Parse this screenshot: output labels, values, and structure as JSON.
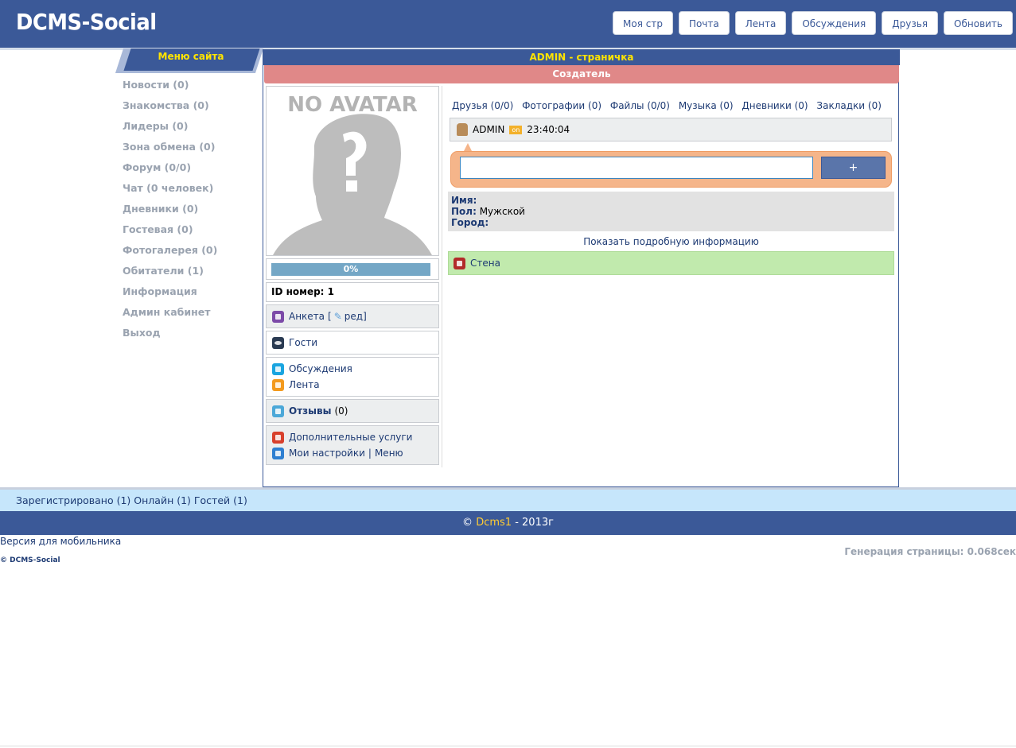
{
  "header": {
    "logo": "DCMS-Social",
    "nav": [
      "Моя стр",
      "Почта",
      "Лента",
      "Обсуждения",
      "Друзья",
      "Обновить"
    ]
  },
  "sidebar": {
    "title": "Меню сайта",
    "items": [
      "Новости (0)",
      "Знакомства (0)",
      "Лидеры (0)",
      "Зона обмена (0)",
      "Форум (0/0)",
      "Чат (0 человек)",
      "Дневники (0)",
      "Гостевая (0)",
      "Фотогалерея (0)",
      "Обитатели (1)",
      "Информация",
      "Админ кабинет",
      "Выход"
    ]
  },
  "profile": {
    "title": "ADMIN - страничка",
    "role": "Создатель",
    "avatar_text": "NO AVATAR",
    "progress": {
      "label": "0%",
      "value": 0
    },
    "id_label": "ID номер: 1",
    "anketa": "Анкета",
    "anketa_open": "[",
    "anketa_edit": "ред",
    "anketa_close": "]",
    "guests": "Гости",
    "discussions": "Обсуждения",
    "feed": "Лента",
    "reviews_label": "Отзывы",
    "reviews_count": "(0)",
    "extra_services": "Дополнительные услуги",
    "my_settings": "Мои настройки",
    "separator": "|",
    "menu": "Меню"
  },
  "tabs": [
    "Друзья (0/0)",
    "Фотографии (0)",
    "Файлы (0/0)",
    "Музыка (0)",
    "Дневники (0)",
    "Закладки (0)"
  ],
  "status": {
    "user": "ADMIN",
    "badge": "on",
    "time": "23:40:04"
  },
  "post": {
    "input_value": "",
    "button": "+"
  },
  "info": {
    "name_label": "Имя:",
    "name_value": "",
    "gender_label": "Пол:",
    "gender_value": "Мужской",
    "city_label": "Город:",
    "city_value": "",
    "more": "Показать подробную информацию",
    "wall": "Стена"
  },
  "footer": {
    "stats": "Зарегистрировано (1) Онлайн (1) Гостей (1)",
    "copyright_prefix": "©",
    "brand": "Dcms1",
    "copyright_suffix": "- 2013г",
    "mobile": "Версия для мобильника",
    "gen": "Генерация страницы: 0.068сек",
    "small_copy": "© DCMS-Social"
  }
}
